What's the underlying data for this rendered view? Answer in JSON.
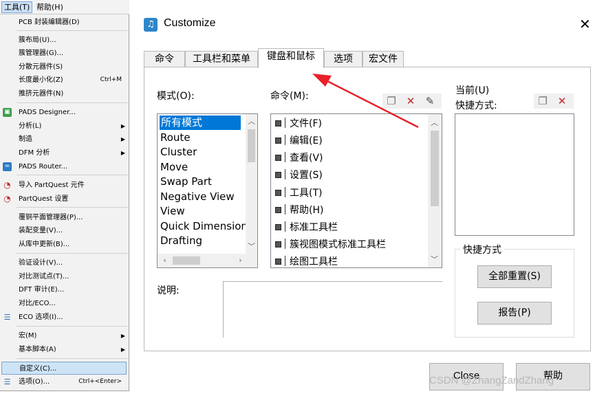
{
  "menubar": {
    "tools": "工具(T)",
    "help": "帮助(H)"
  },
  "menu": {
    "items": [
      {
        "label": "PCB 封装编辑器(D)"
      },
      {
        "label": "簇布局(U)..."
      },
      {
        "label": "簇管理器(G)..."
      },
      {
        "label": "分散元器件(S)"
      },
      {
        "label": "长度最小化(Z)",
        "shortcut": "Ctrl+M"
      },
      {
        "label": "推挤元器件(N)"
      },
      {
        "label": "PADS Designer..."
      },
      {
        "label": "分析(L)"
      },
      {
        "label": "制造"
      },
      {
        "label": "DFM 分析"
      },
      {
        "label": "PADS Router..."
      },
      {
        "label": "导入 PartQuest 元件"
      },
      {
        "label": "PartQuest 设置"
      },
      {
        "label": "覆铜平面管理器(P)..."
      },
      {
        "label": "装配变量(V)..."
      },
      {
        "label": "从库中更新(B)..."
      },
      {
        "label": "验证设计(V)..."
      },
      {
        "label": "对比测试点(T)..."
      },
      {
        "label": "DFT 审计(E)..."
      },
      {
        "label": "对比/ECO..."
      },
      {
        "label": "ECO 选项(I)..."
      },
      {
        "label": "宏(M)"
      },
      {
        "label": "基本脚本(A)"
      },
      {
        "label": "自定义(C)..."
      },
      {
        "label": "选项(O)...",
        "shortcut": "Ctrl+<Enter>"
      }
    ]
  },
  "dialog": {
    "title": "Customize",
    "tabs": [
      "命令",
      "工具栏和菜单",
      "键盘和鼠标",
      "选项",
      "宏文件"
    ],
    "active_tab": "键盘和鼠标",
    "mode_label": "模式(O):",
    "modes": [
      "所有模式",
      "Route",
      "Cluster",
      "Move",
      "Swap Part",
      "Negative View",
      "View",
      "Quick Dimension",
      "Drafting"
    ],
    "selected_mode": "所有模式",
    "commands_label": "命令(M):",
    "commands": [
      "文件(F)",
      "编辑(E)",
      "查看(V)",
      "设置(S)",
      "工具(T)",
      "帮助(H)",
      "标准工具栏",
      "簇视图模式标准工具栏",
      "绘图工具栏"
    ],
    "current_label": "当前(U)",
    "shortcut_label": "快捷方式:",
    "description_label": "说明:",
    "group_label": "快捷方式",
    "reset_all": "全部重置(S)",
    "report": "报告(P)",
    "close_button": "Close",
    "help_button": "帮助"
  },
  "watermark": "CSDN @ZhangZandZhang",
  "colors": {
    "selection": "#0078d7",
    "arrow": "#e8212a",
    "menu_highlight": "#cde4f7"
  }
}
